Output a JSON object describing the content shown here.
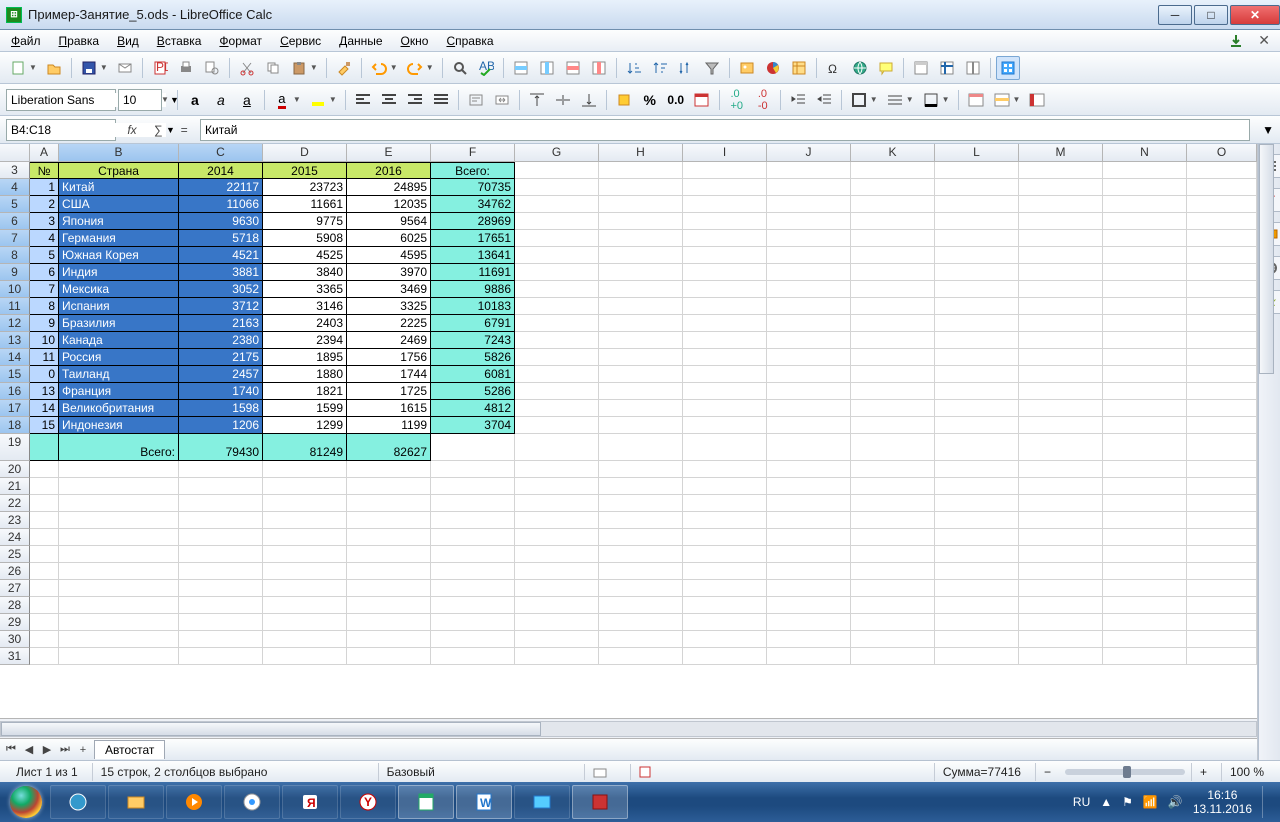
{
  "window": {
    "title": "Пример-Занятие_5.ods - LibreOffice Calc"
  },
  "menu": {
    "items": [
      "Файл",
      "Правка",
      "Вид",
      "Вставка",
      "Формат",
      "Сервис",
      "Данные",
      "Окно",
      "Справка"
    ]
  },
  "font": {
    "name": "Liberation Sans",
    "size": "10"
  },
  "namebox": "B4:C18",
  "formula": "Китай",
  "labels": {
    ".000": ".000"
  },
  "colWidths": [
    "30",
    "29",
    "120",
    "84",
    "84",
    "84",
    "84",
    "84",
    "84",
    "84",
    "84",
    "84",
    "84",
    "84",
    "84",
    "70"
  ],
  "columns": [
    "A",
    "B",
    "C",
    "D",
    "E",
    "F",
    "G",
    "H",
    "I",
    "J",
    "K",
    "L",
    "M",
    "N",
    "O"
  ],
  "selectedCols": [
    "B",
    "C"
  ],
  "headerRow": {
    "num": "3",
    "cells": [
      "№",
      "Страна",
      "2014",
      "2015",
      "2016",
      "Всего:"
    ]
  },
  "dataRows": [
    {
      "num": "4",
      "a": "1",
      "b": "Китай",
      "c": "22117",
      "d": "23723",
      "e": "24895",
      "f": "70735"
    },
    {
      "num": "5",
      "a": "2",
      "b": "США",
      "c": "11066",
      "d": "11661",
      "e": "12035",
      "f": "34762"
    },
    {
      "num": "6",
      "a": "3",
      "b": "Япония",
      "c": "9630",
      "d": "9775",
      "e": "9564",
      "f": "28969"
    },
    {
      "num": "7",
      "a": "4",
      "b": "Германия",
      "c": "5718",
      "d": "5908",
      "e": "6025",
      "f": "17651"
    },
    {
      "num": "8",
      "a": "5",
      "b": "Южная Корея",
      "c": "4521",
      "d": "4525",
      "e": "4595",
      "f": "13641"
    },
    {
      "num": "9",
      "a": "6",
      "b": "Индия",
      "c": "3881",
      "d": "3840",
      "e": "3970",
      "f": "11691"
    },
    {
      "num": "10",
      "a": "7",
      "b": "Мексика",
      "c": "3052",
      "d": "3365",
      "e": "3469",
      "f": "9886"
    },
    {
      "num": "11",
      "a": "8",
      "b": "Испания",
      "c": "3712",
      "d": "3146",
      "e": "3325",
      "f": "10183"
    },
    {
      "num": "12",
      "a": "9",
      "b": "Бразилия",
      "c": "2163",
      "d": "2403",
      "e": "2225",
      "f": "6791"
    },
    {
      "num": "13",
      "a": "10",
      "b": "Канада",
      "c": "2380",
      "d": "2394",
      "e": "2469",
      "f": "7243"
    },
    {
      "num": "14",
      "a": "11",
      "b": "Россия",
      "c": "2175",
      "d": "1895",
      "e": "1756",
      "f": "5826"
    },
    {
      "num": "15",
      "a": "0",
      "b": "Таиланд",
      "c": "2457",
      "d": "1880",
      "e": "1744",
      "f": "6081"
    },
    {
      "num": "16",
      "a": "13",
      "b": "Франция",
      "c": "1740",
      "d": "1821",
      "e": "1725",
      "f": "5286"
    },
    {
      "num": "17",
      "a": "14",
      "b": "Великобритания",
      "c": "1598",
      "d": "1599",
      "e": "1615",
      "f": "4812"
    },
    {
      "num": "18",
      "a": "15",
      "b": "Индонезия",
      "c": "1206",
      "d": "1299",
      "e": "1199",
      "f": "3704"
    }
  ],
  "totalRow": {
    "num": "19",
    "label": "Всего:",
    "c": "79430",
    "d": "81249",
    "e": "82627"
  },
  "emptyRows": [
    "20",
    "21",
    "22",
    "23",
    "24",
    "25",
    "26",
    "27",
    "28",
    "29",
    "30",
    "31"
  ],
  "sheetTab": "Автостат",
  "status": {
    "sheet": "Лист 1 из 1",
    "selection": "15 строк, 2 столбцов выбрано",
    "mode": "Базовый",
    "sum": "Сумма=77416",
    "zoom": "100 %"
  },
  "tray": {
    "lang": "RU",
    "time": "16:16",
    "date": "13.11.2016"
  }
}
